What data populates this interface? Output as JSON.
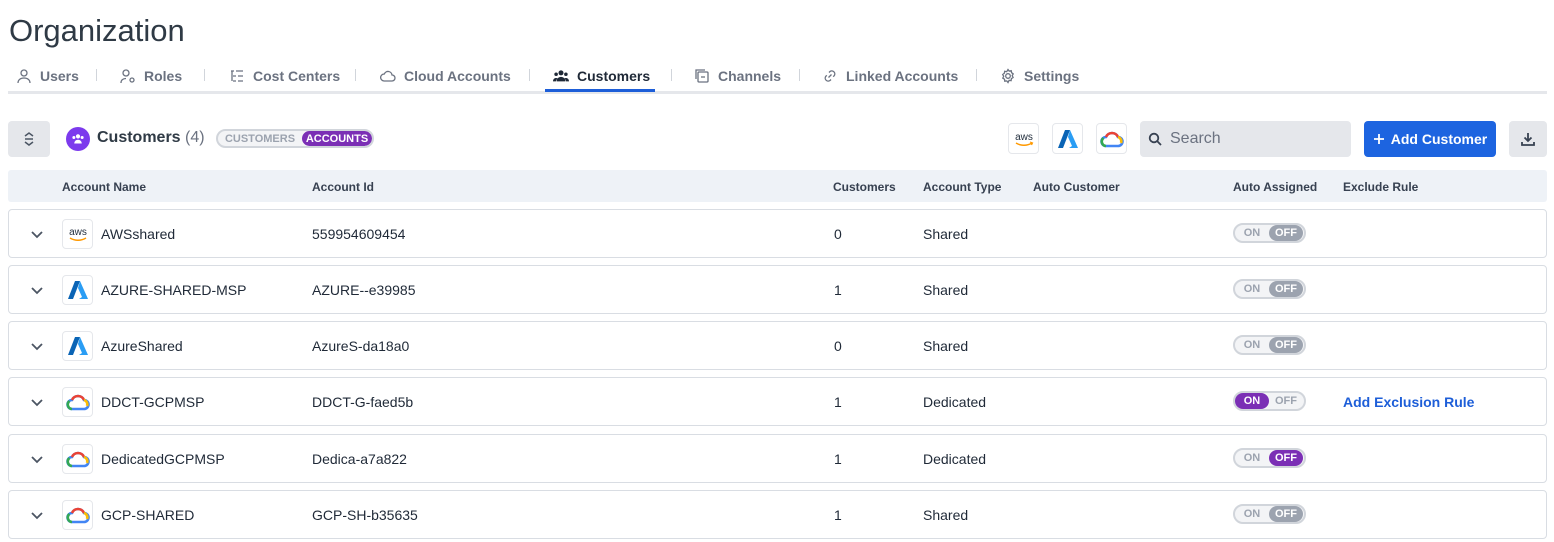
{
  "page": {
    "title": "Organization"
  },
  "tabs": [
    {
      "label": "Users",
      "icon": "user-icon"
    },
    {
      "label": "Roles",
      "icon": "user-gear-icon"
    },
    {
      "label": "Cost Centers",
      "icon": "hierarchy-icon"
    },
    {
      "label": "Cloud Accounts",
      "icon": "cloud-icon"
    },
    {
      "label": "Customers",
      "icon": "users-icon",
      "active": true
    },
    {
      "label": "Channels",
      "icon": "channels-icon"
    },
    {
      "label": "Linked Accounts",
      "icon": "link-icon"
    },
    {
      "label": "Settings",
      "icon": "gear-icon"
    }
  ],
  "section": {
    "title": "Customers",
    "count": "(4)",
    "toggle_off_label": "CUSTOMERS",
    "toggle_on_label": "ACCOUNTS"
  },
  "filters": {
    "aws_label": "aws"
  },
  "search": {
    "placeholder": "Search"
  },
  "actions": {
    "add_customer": "Add Customer"
  },
  "table": {
    "columns": {
      "account_name": "Account Name",
      "account_id": "Account Id",
      "customers": "Customers",
      "account_type": "Account Type",
      "auto_customer": "Auto Customer",
      "auto_assigned": "Auto Assigned",
      "exclude_rule": "Exclude Rule"
    },
    "switch_on_label": "ON",
    "switch_off_label": "OFF",
    "rows": [
      {
        "cloud": "aws",
        "logo_text": "aws",
        "name": "AWSshared",
        "account_id": "559954609454",
        "customers": "0",
        "type": "Shared",
        "auto_assigned": "off",
        "exclude_rule": ""
      },
      {
        "cloud": "azure",
        "name": "AZURE-SHARED-MSP",
        "account_id": "AZURE--e39985",
        "customers": "1",
        "type": "Shared",
        "auto_assigned": "off",
        "exclude_rule": ""
      },
      {
        "cloud": "azure",
        "name": "AzureShared",
        "account_id": "AzureS-da18a0",
        "customers": "0",
        "type": "Shared",
        "auto_assigned": "off",
        "exclude_rule": ""
      },
      {
        "cloud": "gcp",
        "name": "DDCT-GCPMSP",
        "account_id": "DDCT-G-faed5b",
        "customers": "1",
        "type": "Dedicated",
        "auto_assigned": "on",
        "exclude_rule": "Add Exclusion Rule"
      },
      {
        "cloud": "gcp",
        "name": "DedicatedGCPMSP",
        "account_id": "Dedica-a7a822",
        "customers": "1",
        "type": "Dedicated",
        "auto_assigned": "off-highlight",
        "exclude_rule": ""
      },
      {
        "cloud": "gcp",
        "name": "GCP-SHARED",
        "account_id": "GCP-SH-b35635",
        "customers": "1",
        "type": "Shared",
        "auto_assigned": "off",
        "exclude_rule": ""
      }
    ]
  },
  "colors": {
    "accent_blue": "#1d64e0",
    "toggle_purple": "#7b2fb5",
    "aws_orange": "#ff9900",
    "azure_blue": "#0078d4"
  }
}
